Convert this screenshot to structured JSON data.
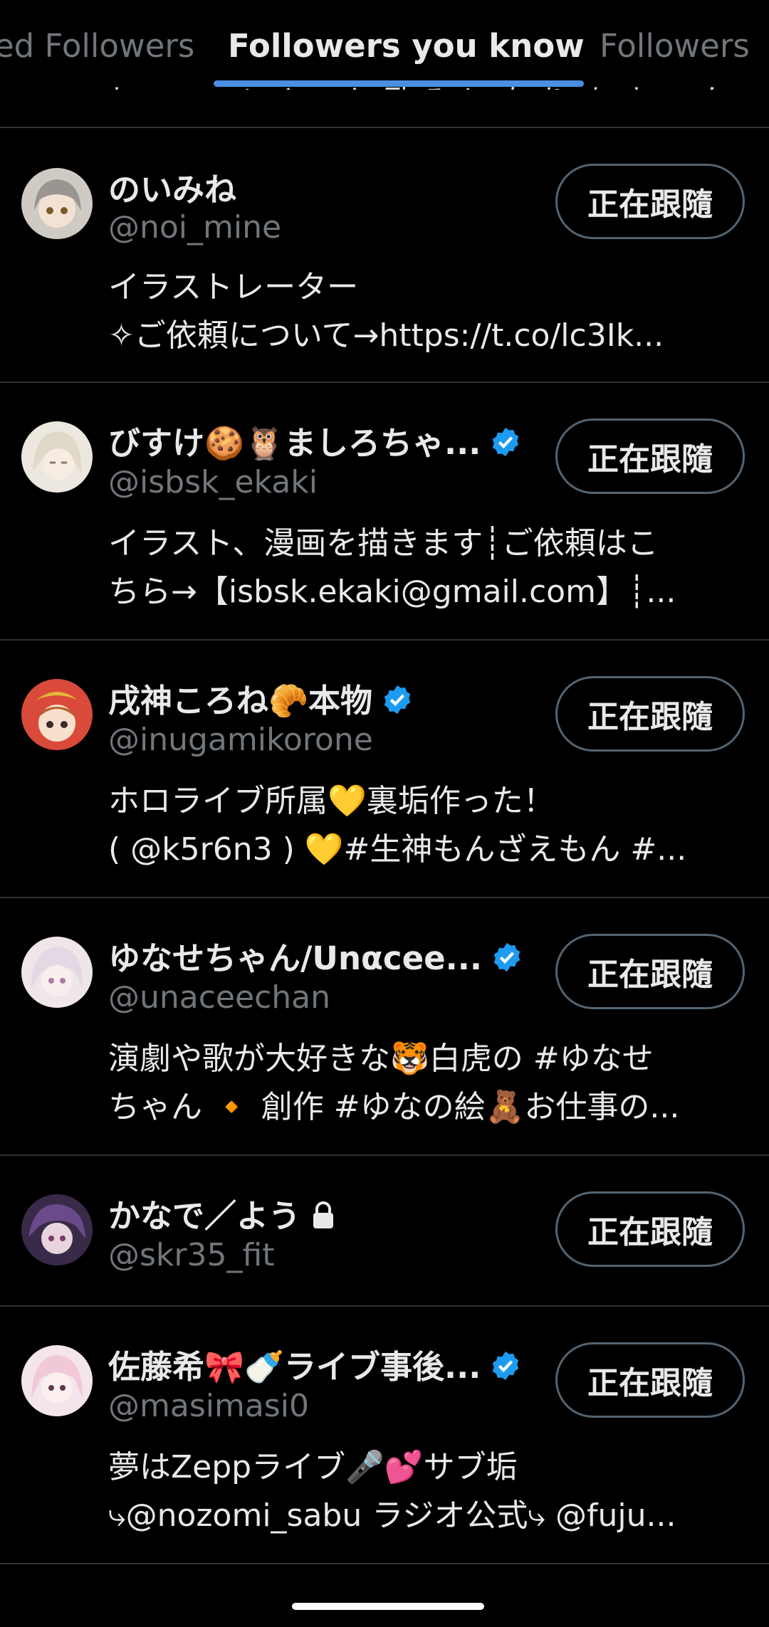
{
  "tabs": {
    "left_label": "ed Followers",
    "active_label": "Followers you know",
    "right_label": "Followers"
  },
  "clipped_bio": "ね ー ッ ノ イ ー ト 励 み に な り ま す ー ク ロ ...",
  "follow_label": "正在跟隨",
  "colors": {
    "verified": "#1d9bf0",
    "indicator": "#4a8fe3",
    "divider": "#2f3336"
  },
  "accounts": [
    {
      "name": "のいみね",
      "handle": "@noi_mine",
      "verified": false,
      "bio": [
        "イラストレーター",
        "✧ご依頼について→https://t.co/lc3Ik..."
      ],
      "button": "正在跟隨"
    },
    {
      "name": "びすけ🍪🦉ましろちゃ...",
      "handle": "@isbsk_ekaki",
      "verified": true,
      "bio": [
        "イラスト、漫画を描きます┊ご依頼はこ",
        "ちら→【isbsk.ekaki@gmail.com】┊..."
      ],
      "button": "正在跟隨"
    },
    {
      "name": "戌神ころね🥐本物",
      "handle": "@inugamikorone",
      "verified": true,
      "bio": [
        "ホロライブ所属💛裏垢作った！",
        "( @k5r6n3 ) 💛#生神もんざえもん #..."
      ],
      "button": "正在跟隨"
    },
    {
      "name": "ゆなせちゃん/Unαcee...",
      "handle": "@unaceechan",
      "verified": true,
      "bio": [
        "演劇や歌が大好きな🐯白虎の #ゆなせ",
        "ちゃん 🔸 創作 #ゆなの絵🧸お仕事の..."
      ],
      "button": "正在跟隨"
    },
    {
      "name": "かなで／よう",
      "handle": "@skr35_fit",
      "verified": false,
      "locked": true,
      "bio": [],
      "button": "正在跟隨"
    },
    {
      "name": "佐藤希🎀🍼ライブ事後...",
      "handle": "@masimasi0",
      "verified": true,
      "bio": [
        "夢はZeppライブ🎤💕サブ垢",
        "⤷@nozomi_sabu ラジオ公式⤷ @fuju..."
      ],
      "button": "正在跟隨"
    }
  ]
}
